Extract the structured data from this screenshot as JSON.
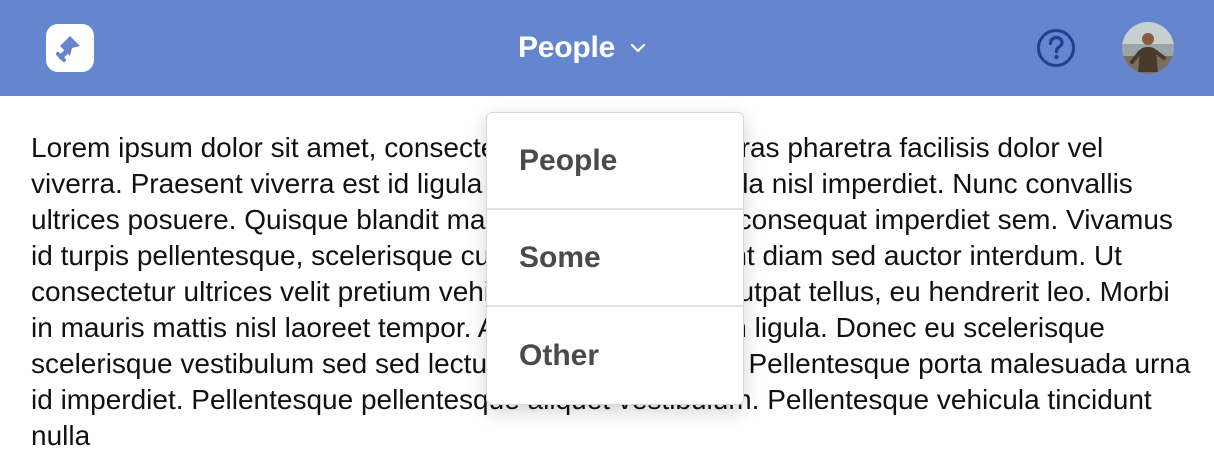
{
  "header": {
    "title": "People",
    "logo_icon": "logo-icon",
    "help_icon": "help-icon",
    "avatar_icon": "user-avatar",
    "background_color": "#6585cf"
  },
  "dropdown": {
    "items": [
      {
        "label": "People"
      },
      {
        "label": "Some"
      },
      {
        "label": "Other"
      }
    ]
  },
  "content": {
    "paragraph": "Lorem ipsum dolor sit amet, consectetur adipiscing elit. Cras pharetra facilisis dolor vel viverra. Praesent viverra est id ligula commodo, vel gravida nisl imperdiet. Nunc convallis ultrices posuere. Quisque blandit malesuada et dui eget, consequat imperdiet sem. Vivamus id turpis pellentesque, scelerisque cursus. Mauris tincidunt diam sed auctor interdum. Ut consectetur ultrices velit pretium vehicula. Vivamus at volutpat tellus, eu hendrerit leo. Morbi in mauris mattis nisl laoreet tempor. Aliquam et sollicitudin ligula. Donec eu scelerisque scelerisque vestibulum sed sed lectus. Proin sed orci est. Pellentesque porta malesuada urna id imperdiet. Pellentesque pellentesque aliquet vestibulum. Pellentesque vehicula tincidunt nulla"
  }
}
